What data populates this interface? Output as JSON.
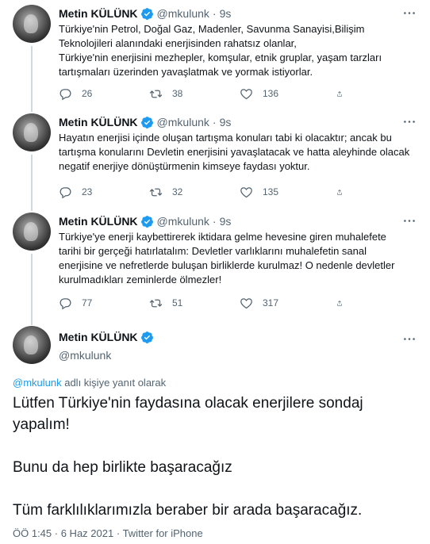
{
  "author": {
    "name": "Metin KÜLÜNK",
    "handle": "@mkulunk"
  },
  "colors": {
    "verified": "#1d9bf0",
    "text": "#0f1419",
    "muted": "#536471",
    "link": "#1d9bf0"
  },
  "tweets": [
    {
      "time": "9s",
      "text": "Türkiye'nin Petrol, Doğal Gaz, Madenler, Savunma Sanayisi,Bilişim\nTeknolojileri alanındaki enerjisinden rahatsız olanlar,\nTürkiye'nin enerjisini mezhepler, komşular, etnik gruplar, yaşam tarzları\ntartışmaları üzerinden yavaşlatmak ve yormak istiyorlar.",
      "replies": "26",
      "retweets": "38",
      "likes": "136"
    },
    {
      "time": "9s",
      "text": "Hayatın enerjisi içinde oluşan tartışma konuları tabi ki olacaktır; ancak bu\ntartışma konularını Devletin enerjisini yavaşlatacak ve hatta aleyhinde olacak\nnegatif enerjiye dönüştürmenin kimseye faydası yoktur.",
      "replies": "23",
      "retweets": "32",
      "likes": "135"
    },
    {
      "time": "9s",
      "text": "Türkiye'ye enerji kaybettirerek iktidara gelme hevesine giren muhalefete\ntarihi bir gerçeği hatırlatalım: Devletler varlıklarını muhalefetin sanal\nenerjisine ve nefretlerde buluşan birliklerde kurulmaz! O nedenle devletler\nkurulmadıkları zeminlerde ölmezler!",
      "replies": "77",
      "retweets": "51",
      "likes": "317"
    }
  ],
  "main_tweet": {
    "reply_mention": "@mkulunk",
    "reply_suffix": " adlı kişiye yanıt olarak",
    "paragraphs": [
      "Lütfen Türkiye'nin faydasına olacak enerjilere sondaj yapalım!",
      "Bunu da hep birlikte başaracağız",
      "Tüm farklılıklarımızla beraber bir arada başaracağız."
    ],
    "time": "ÖÖ 1:45",
    "date": "6 Haz 2021",
    "source": "Twitter for iPhone"
  },
  "icons": {
    "verified": "verified-badge-icon",
    "more": "more-dots-icon",
    "reply": "reply-bubble-icon",
    "retweet": "retweet-icon",
    "like": "heart-icon",
    "share": "share-icon"
  }
}
